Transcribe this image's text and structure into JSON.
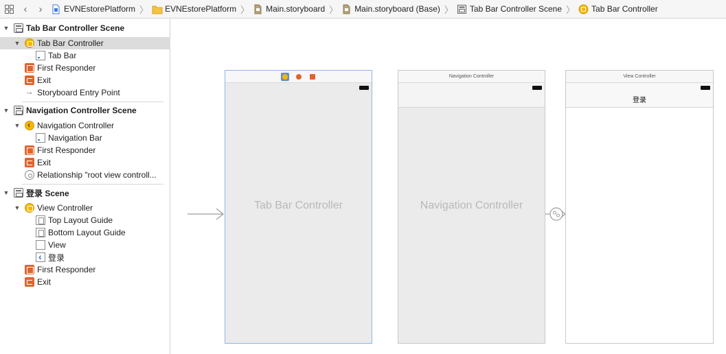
{
  "jumpbar": {
    "crumbs": [
      {
        "label": "EVNEstorePlatform",
        "icon": "project-file-icon"
      },
      {
        "label": "EVNEstorePlatform",
        "icon": "folder-icon"
      },
      {
        "label": "Main.storyboard",
        "icon": "storyboard-file-icon"
      },
      {
        "label": "Main.storyboard (Base)",
        "icon": "storyboard-file-icon"
      },
      {
        "label": "Tab Bar Controller Scene",
        "icon": "scene-icon"
      },
      {
        "label": "Tab Bar Controller",
        "icon": "tab-bar-controller-icon"
      }
    ]
  },
  "outline": {
    "scene1": {
      "title": "Tab Bar Controller Scene",
      "controller": "Tab Bar Controller",
      "tabbar": "Tab Bar",
      "first_responder": "First Responder",
      "exit": "Exit",
      "entry_point": "Storyboard Entry Point"
    },
    "scene2": {
      "title": "Navigation Controller Scene",
      "controller": "Navigation Controller",
      "navbar": "Navigation Bar",
      "first_responder": "First Responder",
      "exit": "Exit",
      "relationship": "Relationship \"root view controll..."
    },
    "scene3": {
      "title": "登录 Scene",
      "controller": "View Controller",
      "top_guide": "Top Layout Guide",
      "bottom_guide": "Bottom Layout Guide",
      "view": "View",
      "nav_item": "登录",
      "first_responder": "First Responder",
      "exit": "Exit"
    }
  },
  "canvas": {
    "tab_bar_controller": {
      "title": "Tab Bar Controller"
    },
    "navigation_controller": {
      "scene_label": "Navigation Controller",
      "title": "Navigation Controller"
    },
    "view_controller": {
      "scene_label": "View Controller",
      "nav_title": "登录"
    }
  }
}
